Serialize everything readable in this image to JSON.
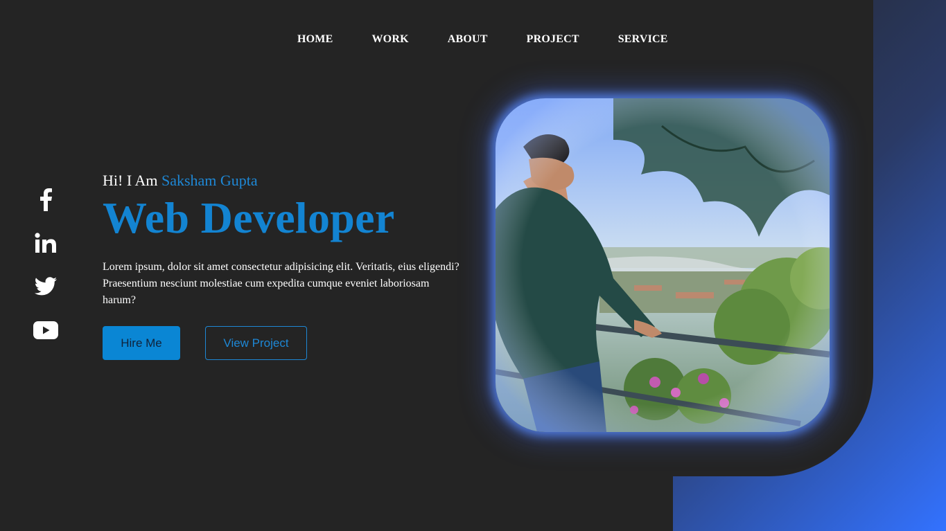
{
  "nav": {
    "items": [
      {
        "label": "HOME"
      },
      {
        "label": "WORK"
      },
      {
        "label": "ABOUT"
      },
      {
        "label": "PROJECT"
      },
      {
        "label": "SERVICE"
      }
    ]
  },
  "socials": [
    {
      "icon": "facebook-icon"
    },
    {
      "icon": "linkedin-icon"
    },
    {
      "icon": "twitter-icon"
    },
    {
      "icon": "youtube-icon"
    }
  ],
  "hero": {
    "greeting_prefix": "Hi! I Am ",
    "name": "Saksham Gupta",
    "headline": "Web Developer",
    "description": "Lorem ipsum, dolor sit amet consectetur adipisicing elit. Veritatis, eius eligendi? Praesentium nesciunt molestiae cum expedita cumque eveniet laboriosam harum?",
    "hire_button": "Hire Me",
    "project_button": "View Project"
  },
  "colors": {
    "background": "#242424",
    "accent": "#1384d2",
    "gradient_end": "#3372ff",
    "text": "#ffffff"
  }
}
